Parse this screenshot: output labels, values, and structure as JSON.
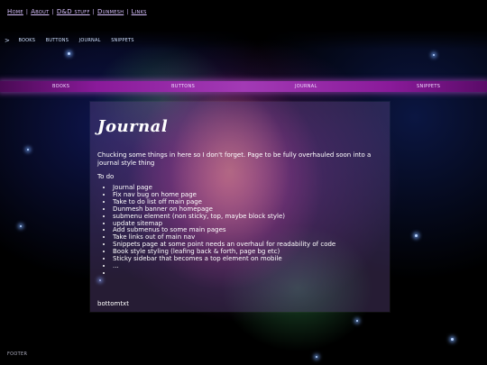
{
  "top_nav": {
    "items": [
      "Home",
      "About",
      "D&D stuff",
      "Dunmesh",
      "Links"
    ]
  },
  "sub_nav": {
    "caret": ">",
    "items": [
      "BOOKS",
      "BUTTONS",
      "JOURNAL",
      "SNIPPETS"
    ]
  },
  "banner": {
    "items": [
      "BOOKS",
      "BUTTONS",
      "JOURNAL",
      "SNIPPETS"
    ]
  },
  "main": {
    "title": "Journal",
    "intro": "Chucking some things in here so I don't forget. Page to be fully overhauled soon into a journal style thing",
    "todo_label": "To do",
    "todo_items": [
      "Journal page",
      "Fix nav bug on home page",
      "Take to do list off main page",
      "Dunmesh banner on homepage",
      "submenu element (non sticky, top, maybe block style)",
      "update sitemap",
      "Add submenus to some main pages",
      "Take links out of main nav",
      "Snippets page at some point needs an overhaul for readability of code",
      "Book style styling (leafing back & forth, page bg etc)",
      "Sticky sidebar that becomes a top element on mobile",
      "...",
      ""
    ],
    "bottom_text": "bottomtxt"
  },
  "footer": {
    "text": "FOOTER"
  },
  "colors": {
    "banner": "#a23ab5",
    "nav_link": "#d8c0ff"
  }
}
